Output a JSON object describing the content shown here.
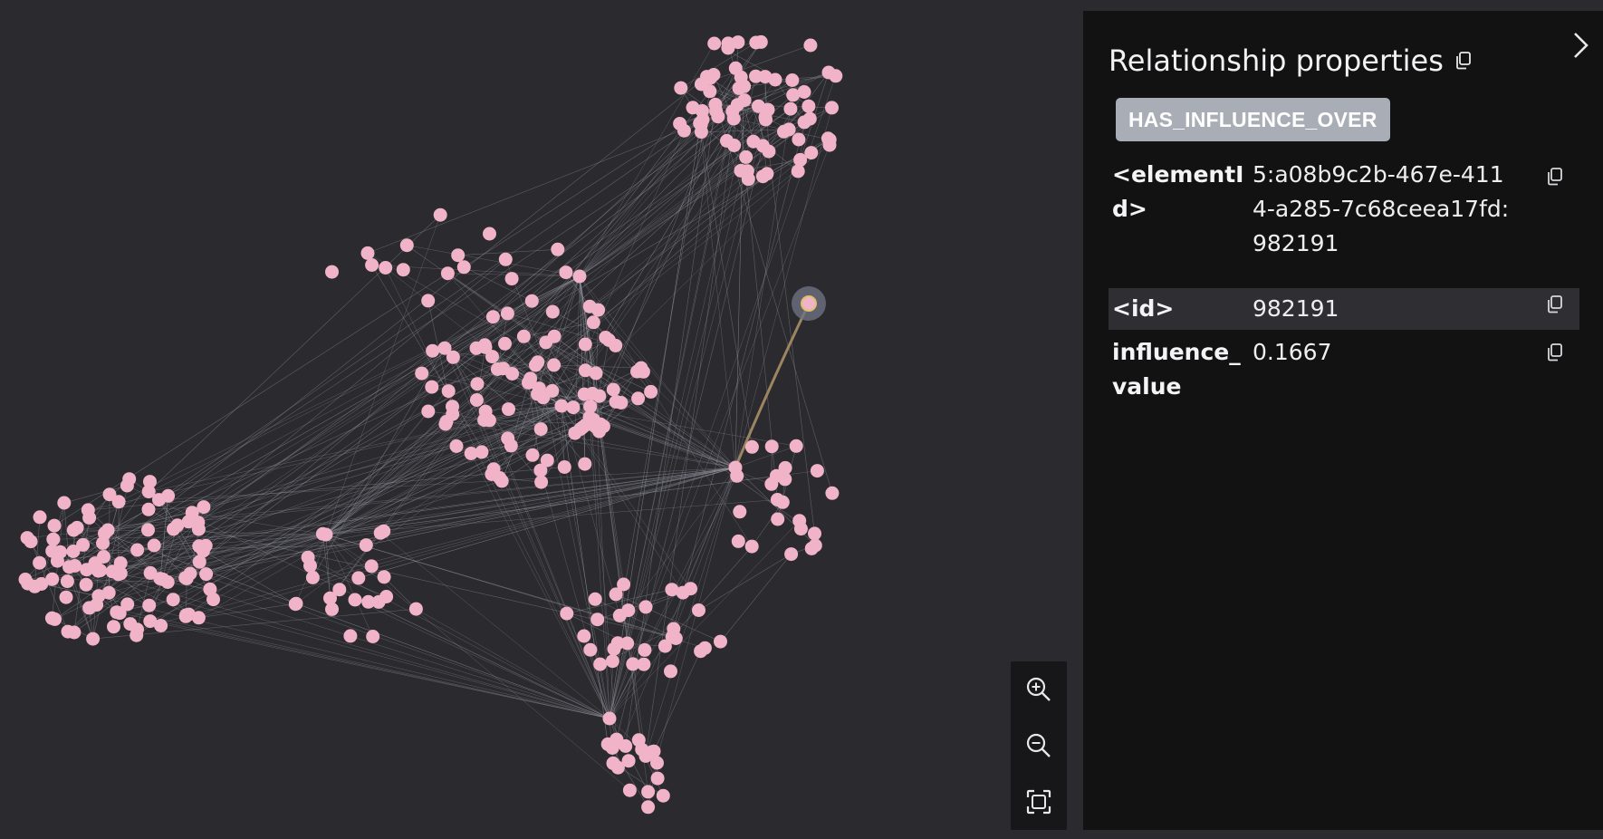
{
  "panel": {
    "title": "Relationship properties",
    "relationship_type": "HAS_INFLUENCE_OVER",
    "properties": [
      {
        "key": "<elementId>",
        "value": "5:a08b9c2b-467e-4114-a285-7c68ceea17fd:982191"
      },
      {
        "key": "<id>",
        "value": "982191"
      },
      {
        "key": "influence_value",
        "value": "0.1667"
      }
    ]
  },
  "colors": {
    "canvas_bg": "#2a2a2f",
    "panel_bg": "#121212",
    "node_fill": "#f1b3c7",
    "edge": "#8a8a94",
    "selected_edge": "#9c8560",
    "badge_bg": "#a9adb6"
  },
  "icons": {
    "copy": "copy-icon",
    "collapse": "chevron-right-icon",
    "zoom_in": "zoom-in-icon",
    "zoom_out": "zoom-out-icon",
    "fit": "fit-to-screen-icon"
  }
}
